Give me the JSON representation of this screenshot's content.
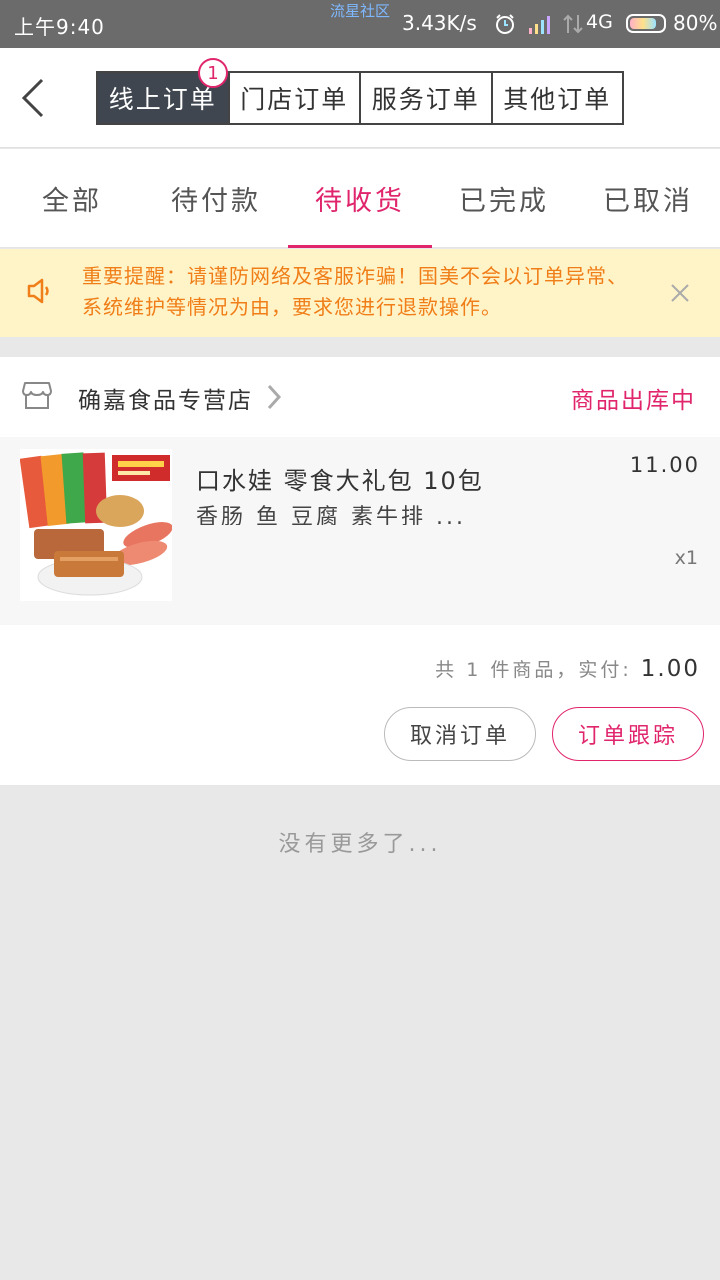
{
  "status_bar": {
    "time": "上午9:40",
    "center_label": "流星社区",
    "net_speed": "3.43K/s",
    "network": "4G",
    "battery_text": "80%",
    "battery_level": 0.8,
    "icons": [
      "alarm-icon",
      "signal-icon",
      "data-arrows-icon",
      "battery-icon"
    ]
  },
  "header": {
    "back_icon": "chevron-left-icon",
    "segments": [
      "线上订单",
      "门店订单",
      "服务订单",
      "其他订单"
    ],
    "active_segment": 0,
    "badge_count": "1"
  },
  "tabs": {
    "items": [
      "全部",
      "待付款",
      "待收货",
      "已完成",
      "已取消"
    ],
    "active": 2,
    "accent_color": "#e0256c"
  },
  "notice": {
    "icon": "speaker-icon",
    "text": "重要提醒：请谨防网络及客服诈骗！国美不会以订单异常、系统维护等情况为由，要求您进行退款操作。",
    "close_icon": "close-icon",
    "color": "#f07e18",
    "background": "#fff4c8"
  },
  "order": {
    "store": {
      "icon": "store-icon",
      "name": "确嘉食品专营店",
      "arrow_icon": "chevron-right-icon",
      "status": "商品出库中"
    },
    "product": {
      "title": "口水娃 零食大礼包 10包",
      "subtitle": "香肠 鱼 豆腐 素牛排 ...",
      "price": "11.00",
      "quantity": "x1"
    },
    "summary": {
      "prefix": "共",
      "count": "1",
      "middle": "件商品，实付:",
      "amount": "1.00"
    },
    "actions": {
      "cancel": "取消订单",
      "track": "订单跟踪"
    }
  },
  "footer": {
    "no_more": "没有更多了..."
  }
}
